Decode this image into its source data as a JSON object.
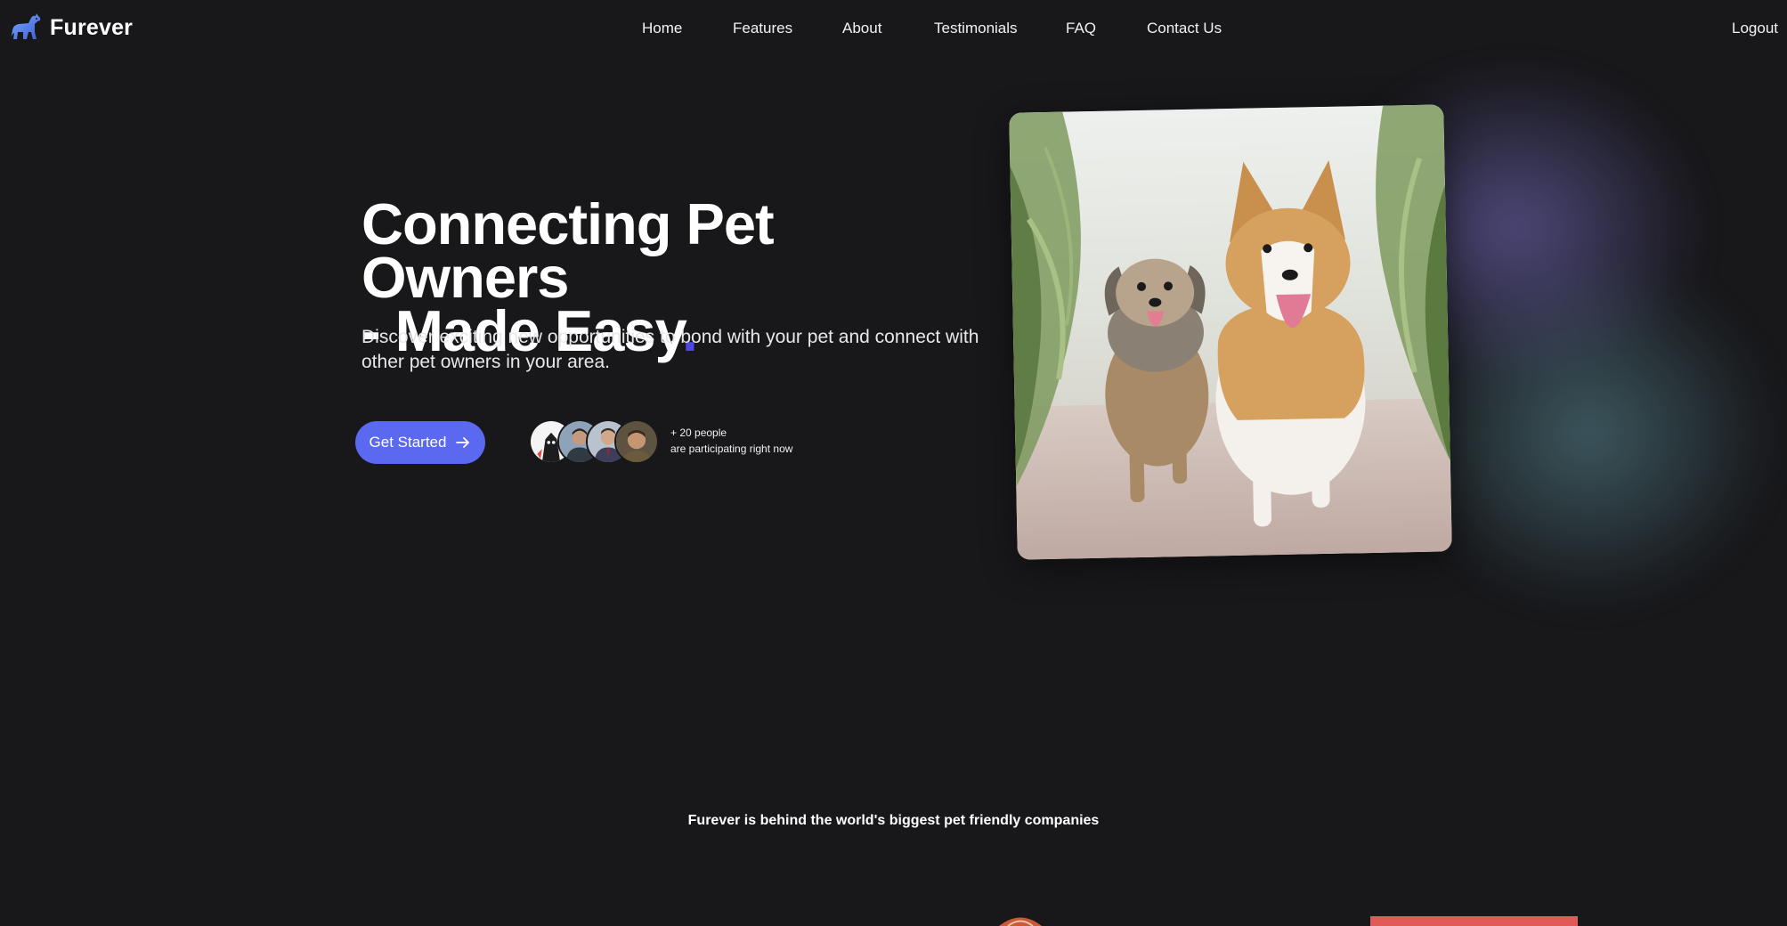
{
  "brand": {
    "name": "Furever",
    "logo_icon": "dog-logo-icon"
  },
  "nav": {
    "links": [
      "Home",
      "Features",
      "About",
      "Testimonials",
      "FAQ",
      "Contact Us"
    ],
    "logout": "Logout"
  },
  "hero": {
    "title_line1": "Connecting Pet Owners",
    "title_line2": "- Made Easy",
    "title_dot": ".",
    "subtitle": "Discover exciting new opportunities to bond with your pet and connect with other pet owners in your area.",
    "cta_label": "Get Started",
    "cta_icon": "arrow-right-icon",
    "participants_line1": "+ 20 people",
    "participants_line2": "are participating right now"
  },
  "tagline": "Furever is behind the world's biggest pet friendly companies",
  "colors": {
    "background": "#18181b",
    "accent": "#5b68f0",
    "title_dot": "#4f46e5",
    "partner_red": "#e05b57"
  }
}
